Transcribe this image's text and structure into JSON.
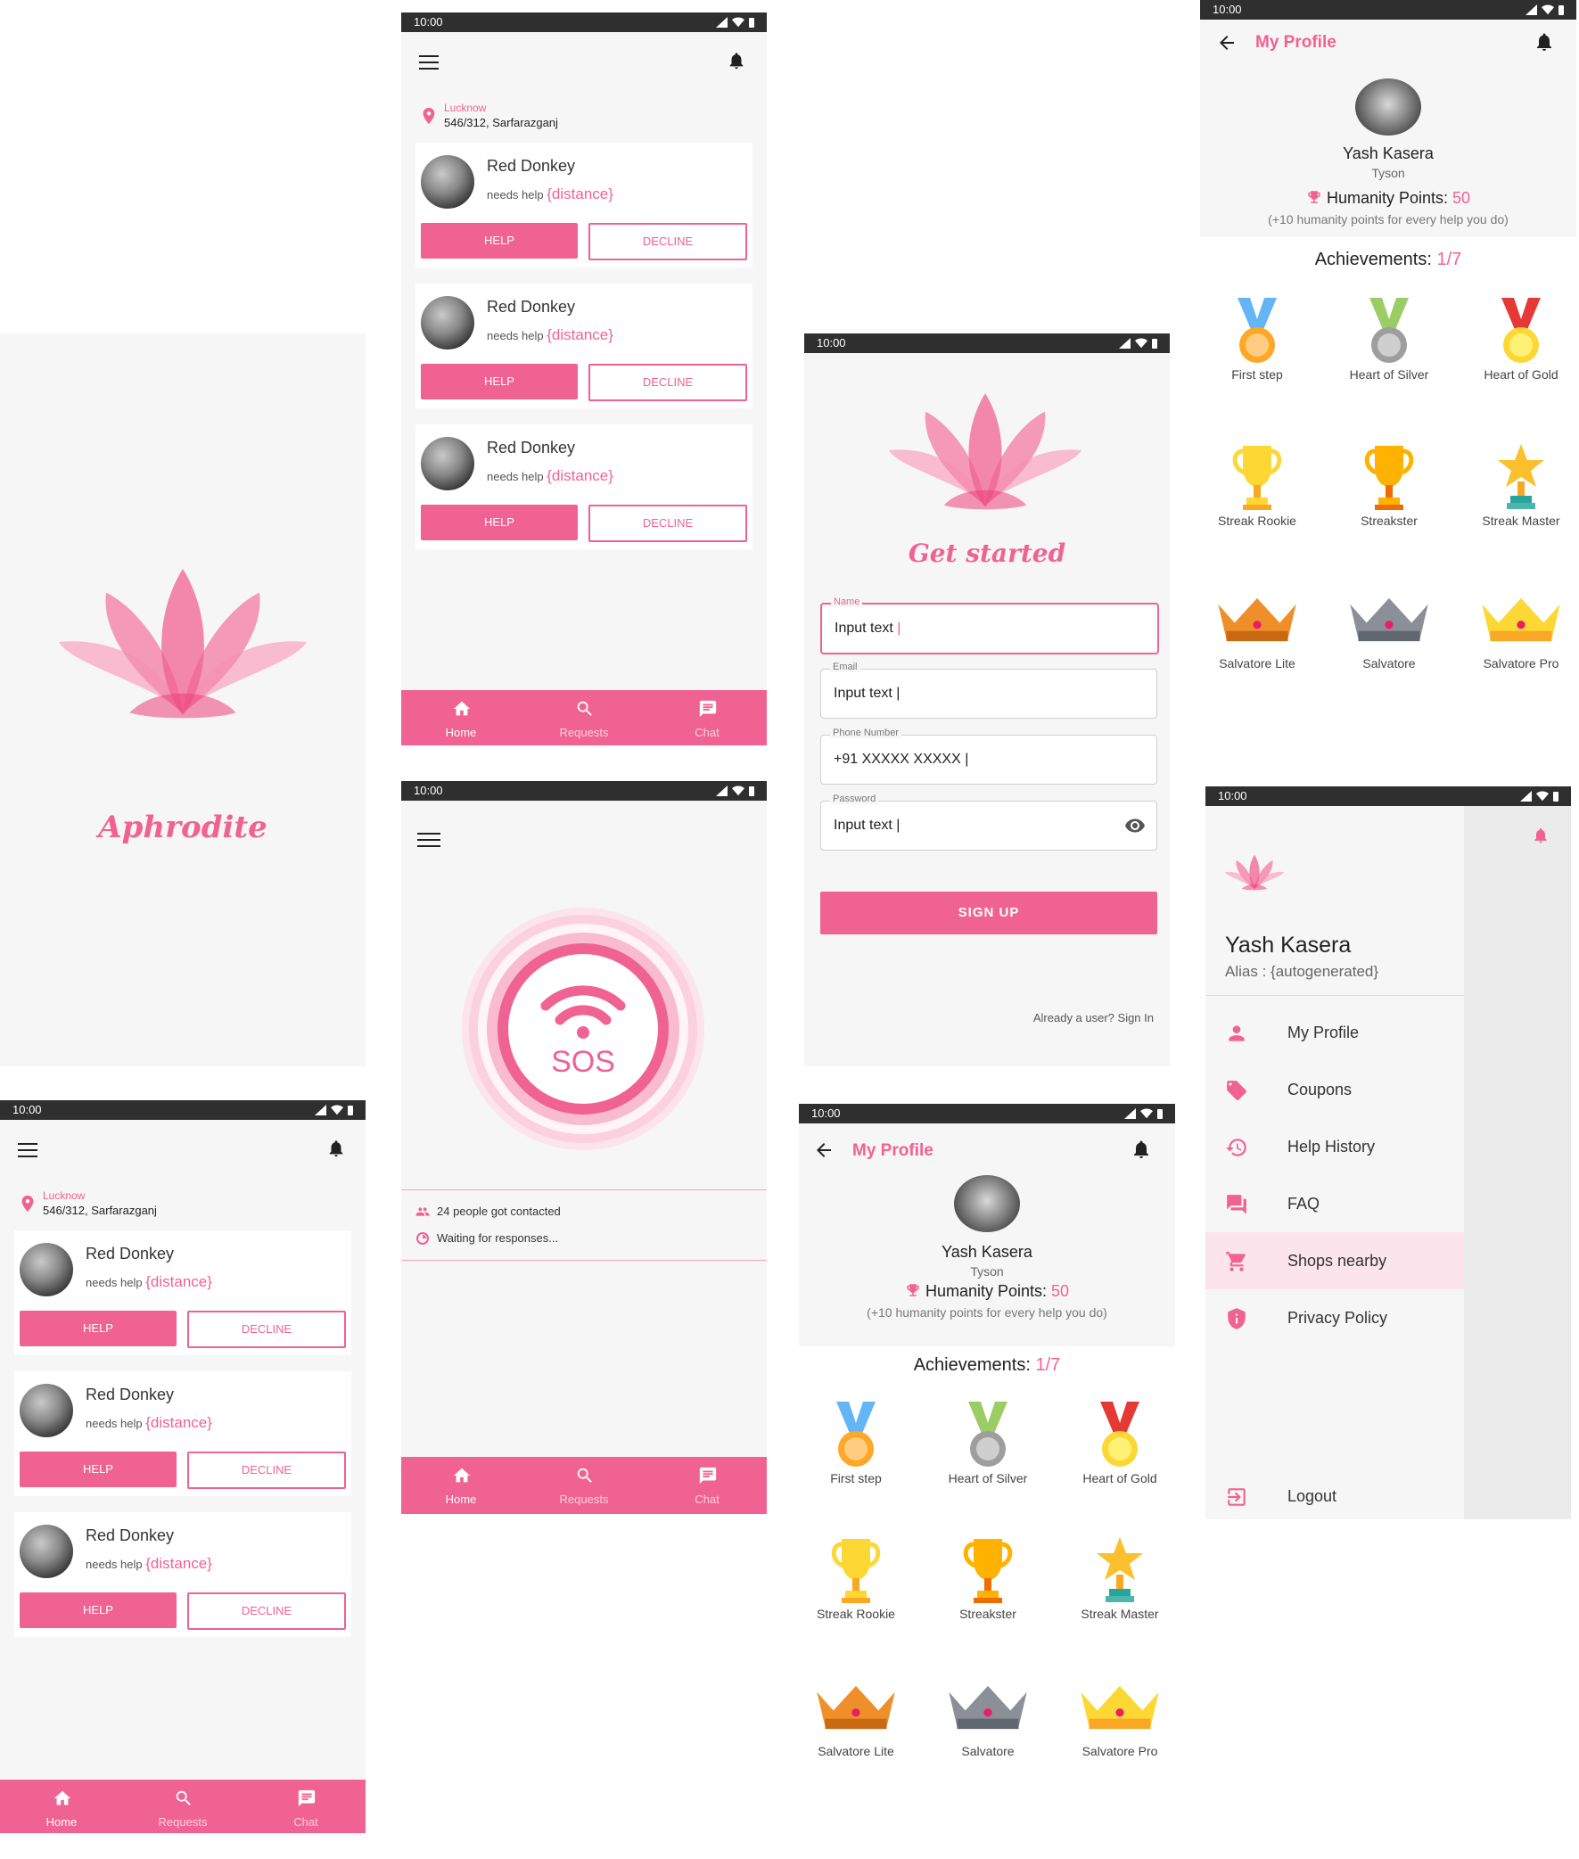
{
  "status": {
    "time": "10:00"
  },
  "splash": {
    "app_name": "Aphrodite"
  },
  "requests": {
    "location_city": "Lucknow",
    "location_address": "546/312, Sarfarazganj",
    "cards": [
      {
        "name": "Red Donkey",
        "needs": "needs help",
        "distance": "{distance}",
        "help": "HELP",
        "decline": "DECLINE"
      },
      {
        "name": "Red Donkey",
        "needs": "needs help",
        "distance": "{distance}",
        "help": "HELP",
        "decline": "DECLINE"
      },
      {
        "name": "Red Donkey",
        "needs": "needs help",
        "distance": "{distance}",
        "help": "HELP",
        "decline": "DECLINE"
      }
    ]
  },
  "nav": {
    "home": "Home",
    "requests": "Requests",
    "chat": "Chat"
  },
  "sos": {
    "label": "SOS",
    "contacted": "24 people got contacted",
    "waiting": "Waiting for responses..."
  },
  "signup": {
    "title": "Get started",
    "name_label": "Name",
    "name_value": "Input text",
    "email_label": "Email",
    "email_value": "Input text",
    "phone_label": "Phone Number",
    "phone_value": "+91 XXXXX XXXXX",
    "password_label": "Password",
    "password_value": "Input text",
    "button": "SIGN UP",
    "signin": "Already a user? Sign In"
  },
  "profile": {
    "title": "My Profile",
    "name": "Yash Kasera",
    "alias": "Tyson",
    "points_label": "Humanity Points:",
    "points_value": "50",
    "points_note": "(+10 humanity points for every help you do)",
    "achievements_label": "Achievements:",
    "achievements_value": "1/7",
    "achievements": [
      {
        "label": "First step",
        "icon": "bronze-medal-icon"
      },
      {
        "label": "Heart of Silver",
        "icon": "silver-medal-icon"
      },
      {
        "label": "Heart of Gold",
        "icon": "gold-medal-icon"
      },
      {
        "label": "Streak Rookie",
        "icon": "yellow-trophy-icon"
      },
      {
        "label": "Streakster",
        "icon": "orange-trophy-icon"
      },
      {
        "label": "Streak Master",
        "icon": "star-trophy-icon"
      },
      {
        "label": "Salvatore Lite",
        "icon": "bronze-crown-icon"
      },
      {
        "label": "Salvatore",
        "icon": "silver-crown-icon"
      },
      {
        "label": "Salvatore Pro",
        "icon": "gold-crown-icon"
      }
    ]
  },
  "drawer": {
    "name": "Yash Kasera",
    "alias": "Alias : {autogenerated}",
    "items": [
      {
        "label": "My Profile",
        "icon": "person-icon"
      },
      {
        "label": "Coupons",
        "icon": "tag-icon"
      },
      {
        "label": "Help History",
        "icon": "history-icon"
      },
      {
        "label": "FAQ",
        "icon": "forum-icon"
      },
      {
        "label": "Shops nearby",
        "icon": "cart-icon"
      },
      {
        "label": "Privacy Policy",
        "icon": "shield-icon"
      }
    ],
    "logout": "Logout"
  },
  "colors": {
    "accent": "#f06292",
    "statusbar": "#2f2f2f",
    "background": "#f6f6f6"
  }
}
